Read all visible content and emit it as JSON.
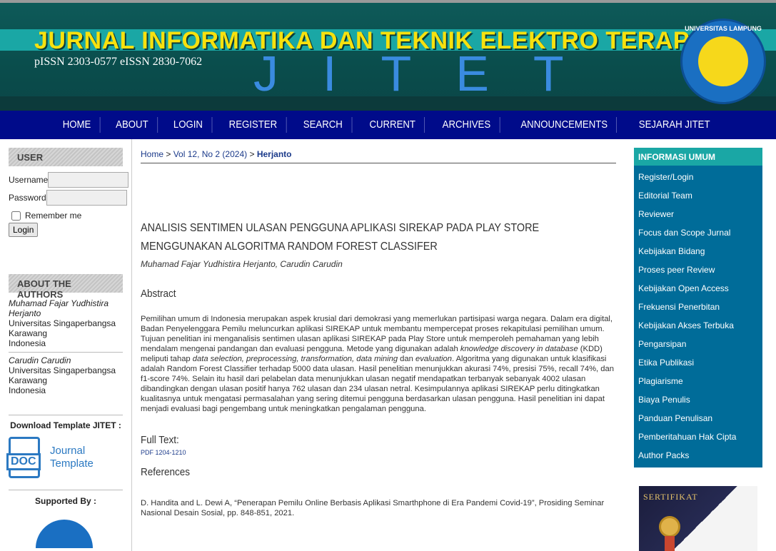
{
  "header": {
    "title": "JURNAL INFORMATIKA DAN TEKNIK ELEKTRO TERAPAN",
    "issn": "pISSN 2303-0577  eISSN 2830-7062",
    "acronym": "JITET",
    "logo_text": "UNIVERSITAS LAMPUNG"
  },
  "nav": [
    "HOME",
    "ABOUT",
    "LOGIN",
    "REGISTER",
    "SEARCH",
    "CURRENT",
    "ARCHIVES",
    "ANNOUNCEMENTS",
    "SEJARAH JITET"
  ],
  "user_block": {
    "heading": "USER",
    "username_label": "Username",
    "password_label": "Password",
    "remember_label": "Remember me",
    "login_button": "Login"
  },
  "authors_block": {
    "heading": "ABOUT THE AUTHORS",
    "authors": [
      {
        "name": "Muhamad Fajar Yudhistira Herjanto",
        "affiliation": "Universitas Singaperbangsa Karawang",
        "country": "Indonesia"
      },
      {
        "name": "Carudin Carudin",
        "affiliation": "Universitas Singaperbangsa Karawang",
        "country": "Indonesia"
      }
    ]
  },
  "template_block": {
    "heading": "Download Template JITET :",
    "icon_text": "DOC",
    "label": "Journal Template"
  },
  "supported_block": {
    "heading": "Supported By :"
  },
  "breadcrumb": {
    "home": "Home",
    "issue": "Vol 12, No 2 (2024)",
    "current": "Herjanto",
    "separator": ">"
  },
  "article": {
    "title": "ANALISIS SENTIMEN ULASAN PENGGUNA APLIKASI SIREKAP PADA PLAY STORE MENGGUNAKAN ALGORITMA RANDOM FOREST CLASSIFER",
    "authors": "Muhamad Fajar Yudhistira Herjanto, Carudin Carudin",
    "abstract_heading": "Abstract",
    "abstract_a": "Pemilihan umum di Indonesia merupakan aspek krusial dari demokrasi yang memerlukan partisipasi warga negara. Dalam era digital, Badan Penyelenggara Pemilu meluncurkan aplikasi SIREKAP untuk membantu mempercepat proses rekapitulasi pemilihan umum. Tujuan penelitian ini menganalisis sentimen ulasan aplikasi SIREKAP pada Play Store untuk memperoleh pemahaman yang lebih mendalam mengenai pandangan dan evaluasi pengguna. Metode yang digunakan adalah ",
    "abstract_em1": "knowledge discovery in database",
    "abstract_b": " (KDD) meliputi tahap ",
    "abstract_em2": "data selection, preprocessing, transformation, data mining",
    "abstract_c": " dan ",
    "abstract_em3": "evaluation",
    "abstract_d": ". Algoritma yang digunakan untuk klasifikasi adalah Random Forest Classifier terhadap 5000 data ulasan. Hasil penelitian menunjukkan akurasi 74%, presisi 75%, recall 74%, dan f1-score 74%. Selain itu hasil dari pelabelan data menunjukkan ulasan negatif mendapatkan terbanyak sebanyak 4002 ulasan dibandingkan dengan ulasan positif  hanya 762 ulasan dan 234 ulasan netral. Kesimpulannya aplikasi SIREKAP perlu ditingkatkan kualitasnya untuk mengatasi permasalahan yang sering ditemui pengguna berdasarkan ulasan pengguna. Hasil penelitian ini dapat menjadi evaluasi bagi pengembang untuk meningkatkan pengalaman pengguna.",
    "fulltext_heading": "Full Text:",
    "pdf_link": "PDF 1204-1210",
    "references_heading": "References",
    "reference_1": "D. Handita and L. Dewi A, “Penerapan Pemilu Online Berbasis Aplikasi Smarthphone di Era Pandemi Covid-19”, Prosiding Seminar Nasional Desain Sosial, pp. 848-851, 2021."
  },
  "info_block": {
    "heading": "INFORMASI UMUM",
    "items": [
      "Register/Login",
      "Editorial Team",
      "Reviewer",
      "Focus dan Scope Jurnal",
      "Kebijakan Bidang",
      "Proses peer Review",
      "Kebijakan Open Access",
      "Frekuensi Penerbitan",
      "Kebijakan Akses Terbuka",
      "Pengarsipan",
      "Etika Publikasi",
      "Plagiarisme",
      "Biaya Penulis",
      "Panduan Penulisan",
      "Pemberitahuan Hak Cipta",
      "Author Packs"
    ]
  },
  "certificate": {
    "title": "SERTIFIKAT"
  },
  "colors": {
    "nav_bg": "#000b8a",
    "accent_teal": "#1aa7a5",
    "info_bg": "#006c99",
    "banner_title": "#f7e10e"
  }
}
